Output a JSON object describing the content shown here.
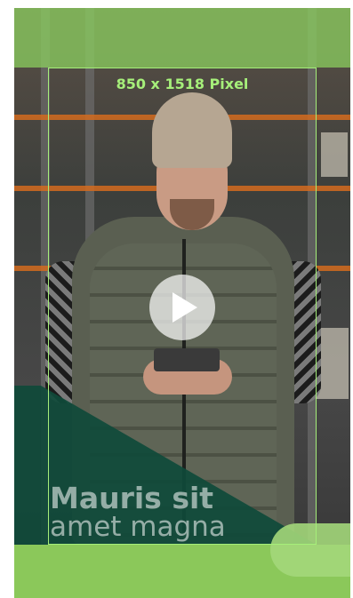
{
  "guide": {
    "dimension_label": "850 x 1518 Pixel"
  },
  "headline": {
    "line1": "Mauris sit",
    "line2": "amet magna"
  },
  "colors": {
    "accent_light_green": "#8bc85a",
    "guide_green": "#a6ef7a",
    "dark_green": "#0f4a3a"
  },
  "icons": {
    "play": "play-icon"
  }
}
